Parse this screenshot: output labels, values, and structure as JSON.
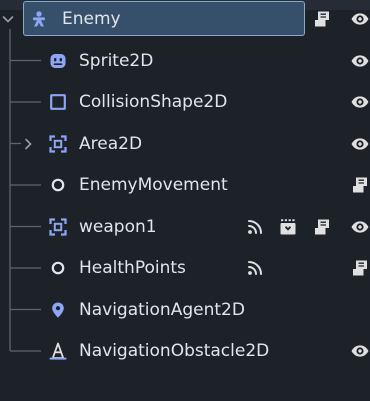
{
  "panel": {
    "selected_index": 0,
    "colors": {
      "background": "#1d2229",
      "selection_fill": "#36506b",
      "selection_border": "#8aa9c7",
      "text": "#e2e5ea",
      "tree_lines": "#5f6570",
      "icon_2d_blue": "#8da5f3",
      "icon_marker": "#8da5f3",
      "icon_obstacle": "#e0e0e0",
      "icon_script": "#e0e0e0",
      "icon_eye": "#e0e0e0"
    }
  },
  "nodes": [
    {
      "label": "Enemy",
      "icon": "character-body-2d-icon",
      "expandable": true,
      "expanded": true,
      "has_script": true,
      "signals": false,
      "groups": false,
      "visible_toggle": true
    },
    {
      "label": "Sprite2D",
      "icon": "sprite-2d-icon",
      "expandable": false,
      "expanded": false,
      "has_script": false,
      "signals": false,
      "groups": false,
      "visible_toggle": true
    },
    {
      "label": "CollisionShape2D",
      "icon": "collision-shape-2d-icon",
      "expandable": false,
      "expanded": false,
      "has_script": false,
      "signals": false,
      "groups": false,
      "visible_toggle": true
    },
    {
      "label": "Area2D",
      "icon": "area-2d-icon",
      "expandable": true,
      "expanded": false,
      "has_script": false,
      "signals": false,
      "groups": false,
      "visible_toggle": true
    },
    {
      "label": "EnemyMovement",
      "icon": "node-icon",
      "expandable": false,
      "expanded": false,
      "has_script": true,
      "signals": false,
      "groups": false,
      "visible_toggle": false
    },
    {
      "label": "weapon1",
      "icon": "area-2d-icon",
      "expandable": false,
      "expanded": false,
      "has_script": true,
      "signals": true,
      "groups": true,
      "visible_toggle": true
    },
    {
      "label": "HealthPoints",
      "icon": "node-icon",
      "expandable": false,
      "expanded": false,
      "has_script": true,
      "signals": true,
      "groups": false,
      "visible_toggle": false
    },
    {
      "label": "NavigationAgent2D",
      "icon": "navigation-agent-2d-icon",
      "expandable": false,
      "expanded": false,
      "has_script": false,
      "signals": false,
      "groups": false,
      "visible_toggle": false
    },
    {
      "label": "NavigationObstacle2D",
      "icon": "navigation-obstacle-2d-icon",
      "expandable": false,
      "expanded": false,
      "has_script": false,
      "signals": false,
      "groups": false,
      "visible_toggle": true
    }
  ]
}
